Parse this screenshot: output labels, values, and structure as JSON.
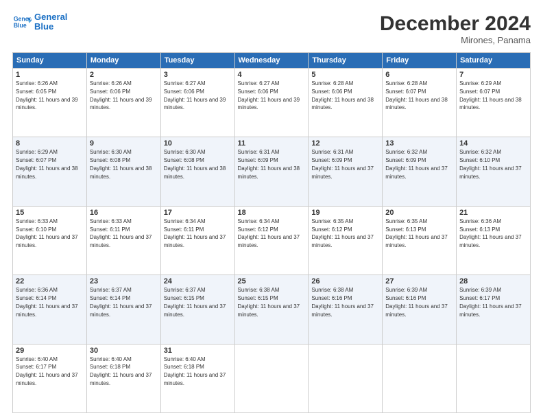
{
  "header": {
    "logo_line1": "General",
    "logo_line2": "Blue",
    "month_title": "December 2024",
    "location": "Mirones, Panama"
  },
  "weekdays": [
    "Sunday",
    "Monday",
    "Tuesday",
    "Wednesday",
    "Thursday",
    "Friday",
    "Saturday"
  ],
  "weeks": [
    [
      {
        "day": "1",
        "sunrise": "6:26 AM",
        "sunset": "6:05 PM",
        "daylight": "11 hours and 39 minutes."
      },
      {
        "day": "2",
        "sunrise": "6:26 AM",
        "sunset": "6:06 PM",
        "daylight": "11 hours and 39 minutes."
      },
      {
        "day": "3",
        "sunrise": "6:27 AM",
        "sunset": "6:06 PM",
        "daylight": "11 hours and 39 minutes."
      },
      {
        "day": "4",
        "sunrise": "6:27 AM",
        "sunset": "6:06 PM",
        "daylight": "11 hours and 39 minutes."
      },
      {
        "day": "5",
        "sunrise": "6:28 AM",
        "sunset": "6:06 PM",
        "daylight": "11 hours and 38 minutes."
      },
      {
        "day": "6",
        "sunrise": "6:28 AM",
        "sunset": "6:07 PM",
        "daylight": "11 hours and 38 minutes."
      },
      {
        "day": "7",
        "sunrise": "6:29 AM",
        "sunset": "6:07 PM",
        "daylight": "11 hours and 38 minutes."
      }
    ],
    [
      {
        "day": "8",
        "sunrise": "6:29 AM",
        "sunset": "6:07 PM",
        "daylight": "11 hours and 38 minutes."
      },
      {
        "day": "9",
        "sunrise": "6:30 AM",
        "sunset": "6:08 PM",
        "daylight": "11 hours and 38 minutes."
      },
      {
        "day": "10",
        "sunrise": "6:30 AM",
        "sunset": "6:08 PM",
        "daylight": "11 hours and 38 minutes."
      },
      {
        "day": "11",
        "sunrise": "6:31 AM",
        "sunset": "6:09 PM",
        "daylight": "11 hours and 38 minutes."
      },
      {
        "day": "12",
        "sunrise": "6:31 AM",
        "sunset": "6:09 PM",
        "daylight": "11 hours and 37 minutes."
      },
      {
        "day": "13",
        "sunrise": "6:32 AM",
        "sunset": "6:09 PM",
        "daylight": "11 hours and 37 minutes."
      },
      {
        "day": "14",
        "sunrise": "6:32 AM",
        "sunset": "6:10 PM",
        "daylight": "11 hours and 37 minutes."
      }
    ],
    [
      {
        "day": "15",
        "sunrise": "6:33 AM",
        "sunset": "6:10 PM",
        "daylight": "11 hours and 37 minutes."
      },
      {
        "day": "16",
        "sunrise": "6:33 AM",
        "sunset": "6:11 PM",
        "daylight": "11 hours and 37 minutes."
      },
      {
        "day": "17",
        "sunrise": "6:34 AM",
        "sunset": "6:11 PM",
        "daylight": "11 hours and 37 minutes."
      },
      {
        "day": "18",
        "sunrise": "6:34 AM",
        "sunset": "6:12 PM",
        "daylight": "11 hours and 37 minutes."
      },
      {
        "day": "19",
        "sunrise": "6:35 AM",
        "sunset": "6:12 PM",
        "daylight": "11 hours and 37 minutes."
      },
      {
        "day": "20",
        "sunrise": "6:35 AM",
        "sunset": "6:13 PM",
        "daylight": "11 hours and 37 minutes."
      },
      {
        "day": "21",
        "sunrise": "6:36 AM",
        "sunset": "6:13 PM",
        "daylight": "11 hours and 37 minutes."
      }
    ],
    [
      {
        "day": "22",
        "sunrise": "6:36 AM",
        "sunset": "6:14 PM",
        "daylight": "11 hours and 37 minutes."
      },
      {
        "day": "23",
        "sunrise": "6:37 AM",
        "sunset": "6:14 PM",
        "daylight": "11 hours and 37 minutes."
      },
      {
        "day": "24",
        "sunrise": "6:37 AM",
        "sunset": "6:15 PM",
        "daylight": "11 hours and 37 minutes."
      },
      {
        "day": "25",
        "sunrise": "6:38 AM",
        "sunset": "6:15 PM",
        "daylight": "11 hours and 37 minutes."
      },
      {
        "day": "26",
        "sunrise": "6:38 AM",
        "sunset": "6:16 PM",
        "daylight": "11 hours and 37 minutes."
      },
      {
        "day": "27",
        "sunrise": "6:39 AM",
        "sunset": "6:16 PM",
        "daylight": "11 hours and 37 minutes."
      },
      {
        "day": "28",
        "sunrise": "6:39 AM",
        "sunset": "6:17 PM",
        "daylight": "11 hours and 37 minutes."
      }
    ],
    [
      {
        "day": "29",
        "sunrise": "6:40 AM",
        "sunset": "6:17 PM",
        "daylight": "11 hours and 37 minutes."
      },
      {
        "day": "30",
        "sunrise": "6:40 AM",
        "sunset": "6:18 PM",
        "daylight": "11 hours and 37 minutes."
      },
      {
        "day": "31",
        "sunrise": "6:40 AM",
        "sunset": "6:18 PM",
        "daylight": "11 hours and 37 minutes."
      },
      null,
      null,
      null,
      null
    ]
  ]
}
